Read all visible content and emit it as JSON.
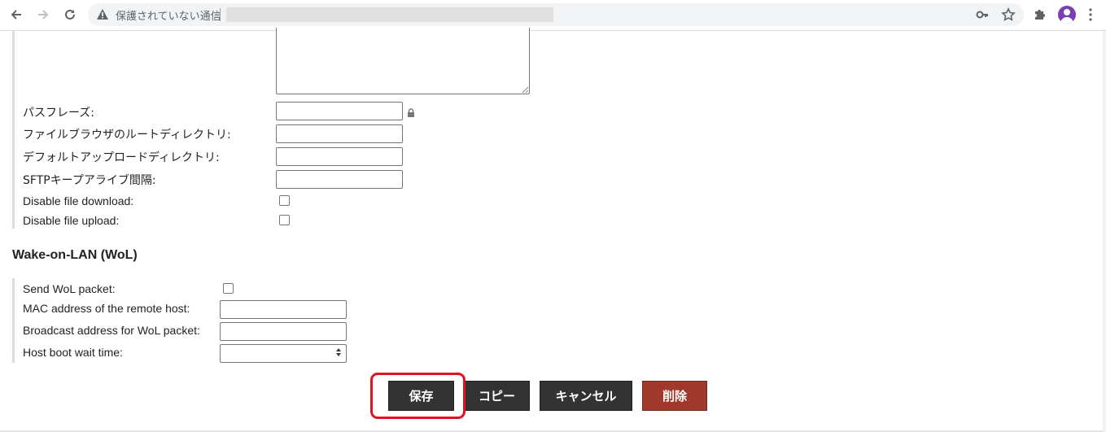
{
  "browser": {
    "security_text": "保護されていない通信",
    "icons": [
      "back-icon",
      "forward-icon",
      "reload-icon",
      "warning-icon",
      "key-icon",
      "star-icon",
      "extensions-icon",
      "profile-avatar",
      "menu-icon"
    ]
  },
  "sftp": {
    "fields": [
      {
        "label": "パスフレーズ:",
        "type": "password"
      },
      {
        "label": "ファイルブラウザのルートディレクトリ:",
        "type": "text"
      },
      {
        "label": "デフォルトアップロードディレクトリ:",
        "type": "text"
      },
      {
        "label": "SFTPキープアライブ間隔:",
        "type": "text"
      },
      {
        "label": "Disable file download:",
        "type": "checkbox",
        "checked": false
      },
      {
        "label": "Disable file upload:",
        "type": "checkbox",
        "checked": false
      }
    ]
  },
  "wol": {
    "title": "Wake-on-LAN (WoL)",
    "fields": [
      {
        "label": "Send WoL packet:",
        "type": "checkbox",
        "checked": false
      },
      {
        "label": "MAC address of the remote host:",
        "type": "text"
      },
      {
        "label": "Broadcast address for WoL packet:",
        "type": "text"
      },
      {
        "label": "Host boot wait time:",
        "type": "number"
      }
    ]
  },
  "buttons": {
    "save": "保存",
    "copy": "コピー",
    "cancel": "キャンセル",
    "delete": "削除"
  },
  "colors": {
    "button_dark": "#333333",
    "button_delete": "#a0392c",
    "highlight": "#e0141e"
  }
}
